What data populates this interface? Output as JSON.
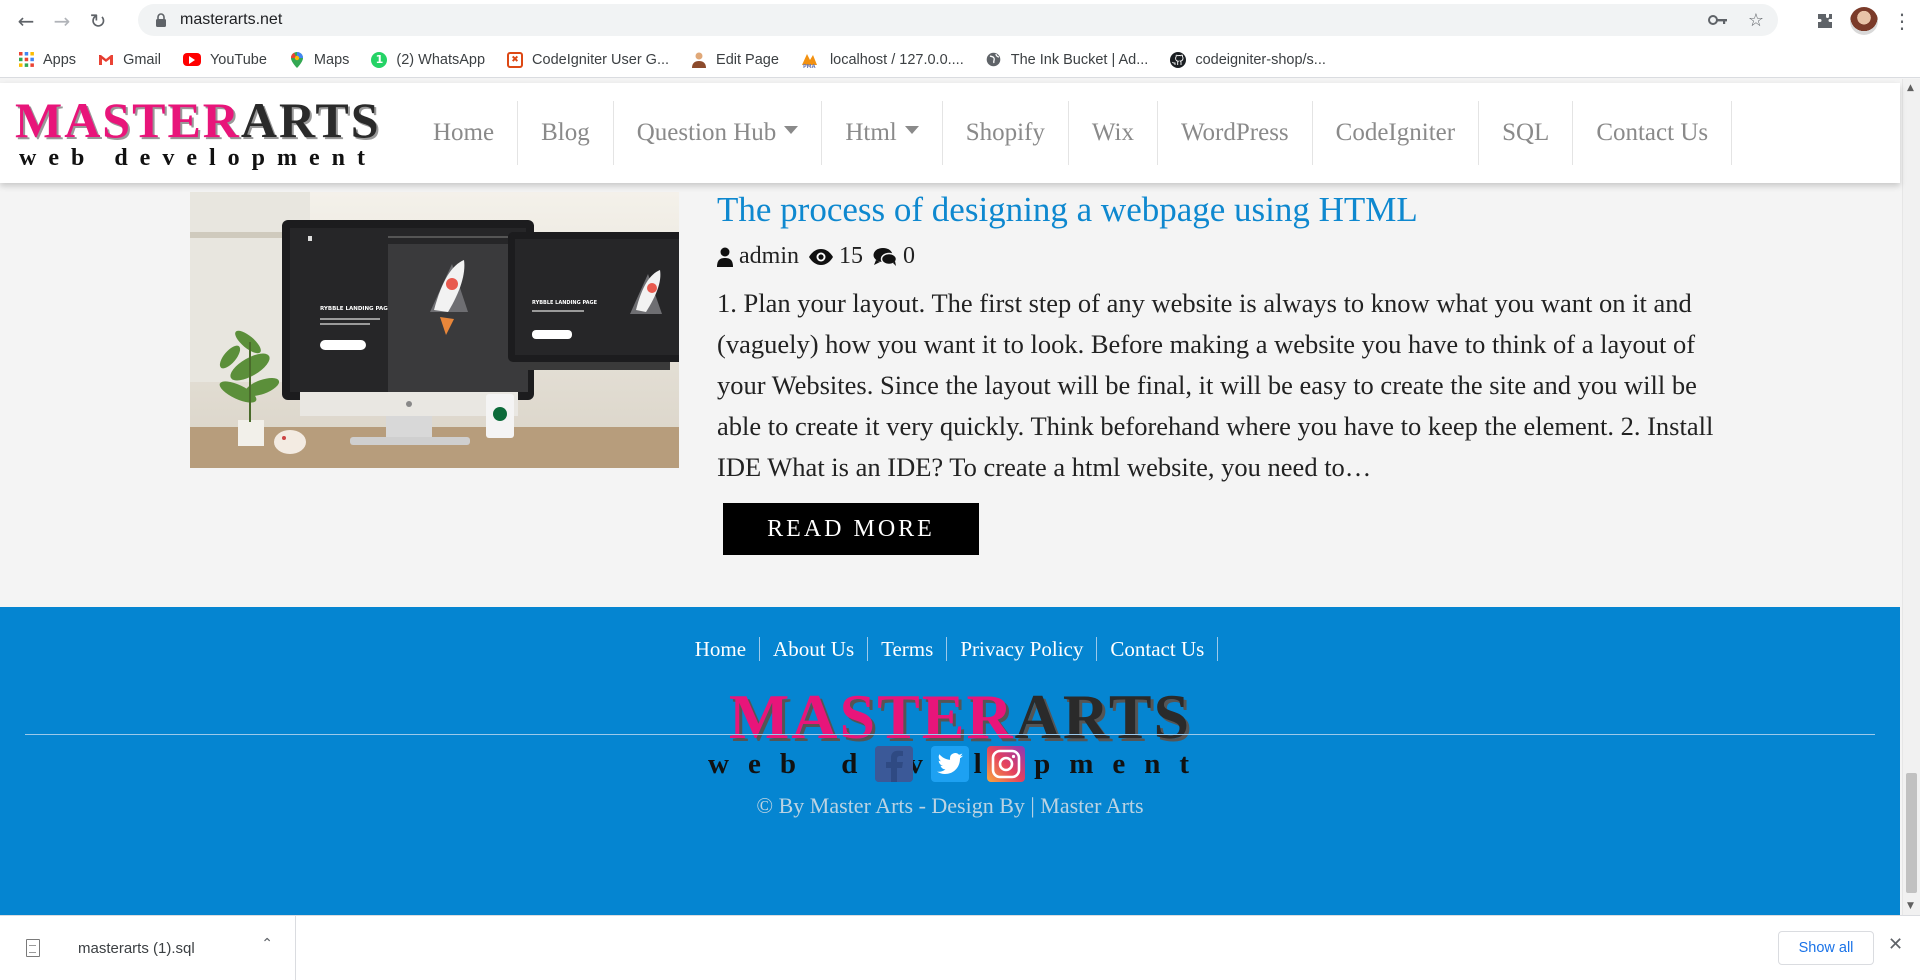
{
  "browser": {
    "url": "masterarts.net",
    "bookmarks": [
      {
        "label": "Apps",
        "icon": "apps-grid-icon"
      },
      {
        "label": "Gmail",
        "icon": "gmail-icon"
      },
      {
        "label": "YouTube",
        "icon": "youtube-icon"
      },
      {
        "label": "Maps",
        "icon": "maps-icon"
      },
      {
        "label": "(2) WhatsApp",
        "icon": "whatsapp-icon"
      },
      {
        "label": "CodeIgniter User G...",
        "icon": "codeigniter-icon"
      },
      {
        "label": "Edit Page",
        "icon": "person-icon"
      },
      {
        "label": "localhost / 127.0.0....",
        "icon": "phpmyadmin-icon"
      },
      {
        "label": "The Ink Bucket | Ad...",
        "icon": "globe-icon"
      },
      {
        "label": "codeigniter-shop/s...",
        "icon": "github-icon"
      }
    ]
  },
  "site": {
    "logo": {
      "part1": "MASTER",
      "part2": "ARTS",
      "tagline": "web development"
    },
    "nav": [
      {
        "label": "Home",
        "dropdown": false
      },
      {
        "label": "Blog",
        "dropdown": false
      },
      {
        "label": "Question Hub",
        "dropdown": true
      },
      {
        "label": "Html",
        "dropdown": true
      },
      {
        "label": "Shopify",
        "dropdown": false
      },
      {
        "label": "Wix",
        "dropdown": false
      },
      {
        "label": "WordPress",
        "dropdown": false
      },
      {
        "label": "CodeIgniter",
        "dropdown": false
      },
      {
        "label": "SQL",
        "dropdown": false
      },
      {
        "label": "Contact Us",
        "dropdown": false
      }
    ]
  },
  "post": {
    "title": "The process of designing a webpage using HTML",
    "author": "admin",
    "views": "15",
    "comments": "0",
    "excerpt": "1. Plan your layout. The first step of any website is always to know what you want on it and (vaguely) how you want it to look. Before making a website you have to think of a layout of your Websites. Since the layout will be final, it will be easy to create the site and you will be able to create it very quickly. Think beforehand where you have to keep the element. 2. Install IDE   What is an IDE? To create a html website, you need to…",
    "read_more": "READ MORE",
    "thumb": {
      "screen_text": "RYBBLE LANDING PAGE"
    }
  },
  "footer": {
    "links": [
      "Home",
      "About Us",
      "Terms",
      "Privacy Policy",
      "Contact Us"
    ],
    "copyright": "© By Master Arts - Design By | Master Arts",
    "social": [
      "facebook-icon",
      "twitter-icon",
      "instagram-icon"
    ]
  },
  "downloads": {
    "file": "masterarts (1).sql",
    "show_all": "Show all"
  },
  "colors": {
    "title_blue": "#0e88cf",
    "footer_blue": "#0585d1",
    "logo_pink": "#e8157a",
    "button_black": "#000000"
  }
}
